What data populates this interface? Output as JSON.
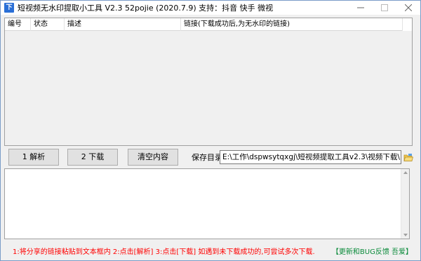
{
  "window": {
    "title": "短视频无水印提取小工具 V2.3   52pojie (2020.7.9)    支持：抖音 快手 微视"
  },
  "table": {
    "columns": [
      "编号",
      "状态",
      "描述",
      "链接(下载成功后,为无水印的链接)"
    ],
    "rows": []
  },
  "buttons": {
    "parse": "1 解析",
    "download": "2 下载",
    "clear": "清空内容"
  },
  "save": {
    "label": "保存目录",
    "path": "E:\\工作\\dspwsytqxgj\\短视频提取工具v2.3\\视频下载\\"
  },
  "log_text": "",
  "footer": {
    "instructions": "1:将分享的链接粘贴到文本框内  2:点击[解析]  3:点击[下载]  如遇到未下载成功的,可尝试多次下载.",
    "update_link": "【更新和BUG反馈 吾爱】"
  },
  "colors": {
    "instruction_text": "#ff0000",
    "link_text": "#0a8a3a",
    "app_icon": "#2a6fd6"
  },
  "icons": [
    "app-icon",
    "minimize-icon",
    "maximize-icon",
    "close-icon",
    "folder-open-icon"
  ]
}
